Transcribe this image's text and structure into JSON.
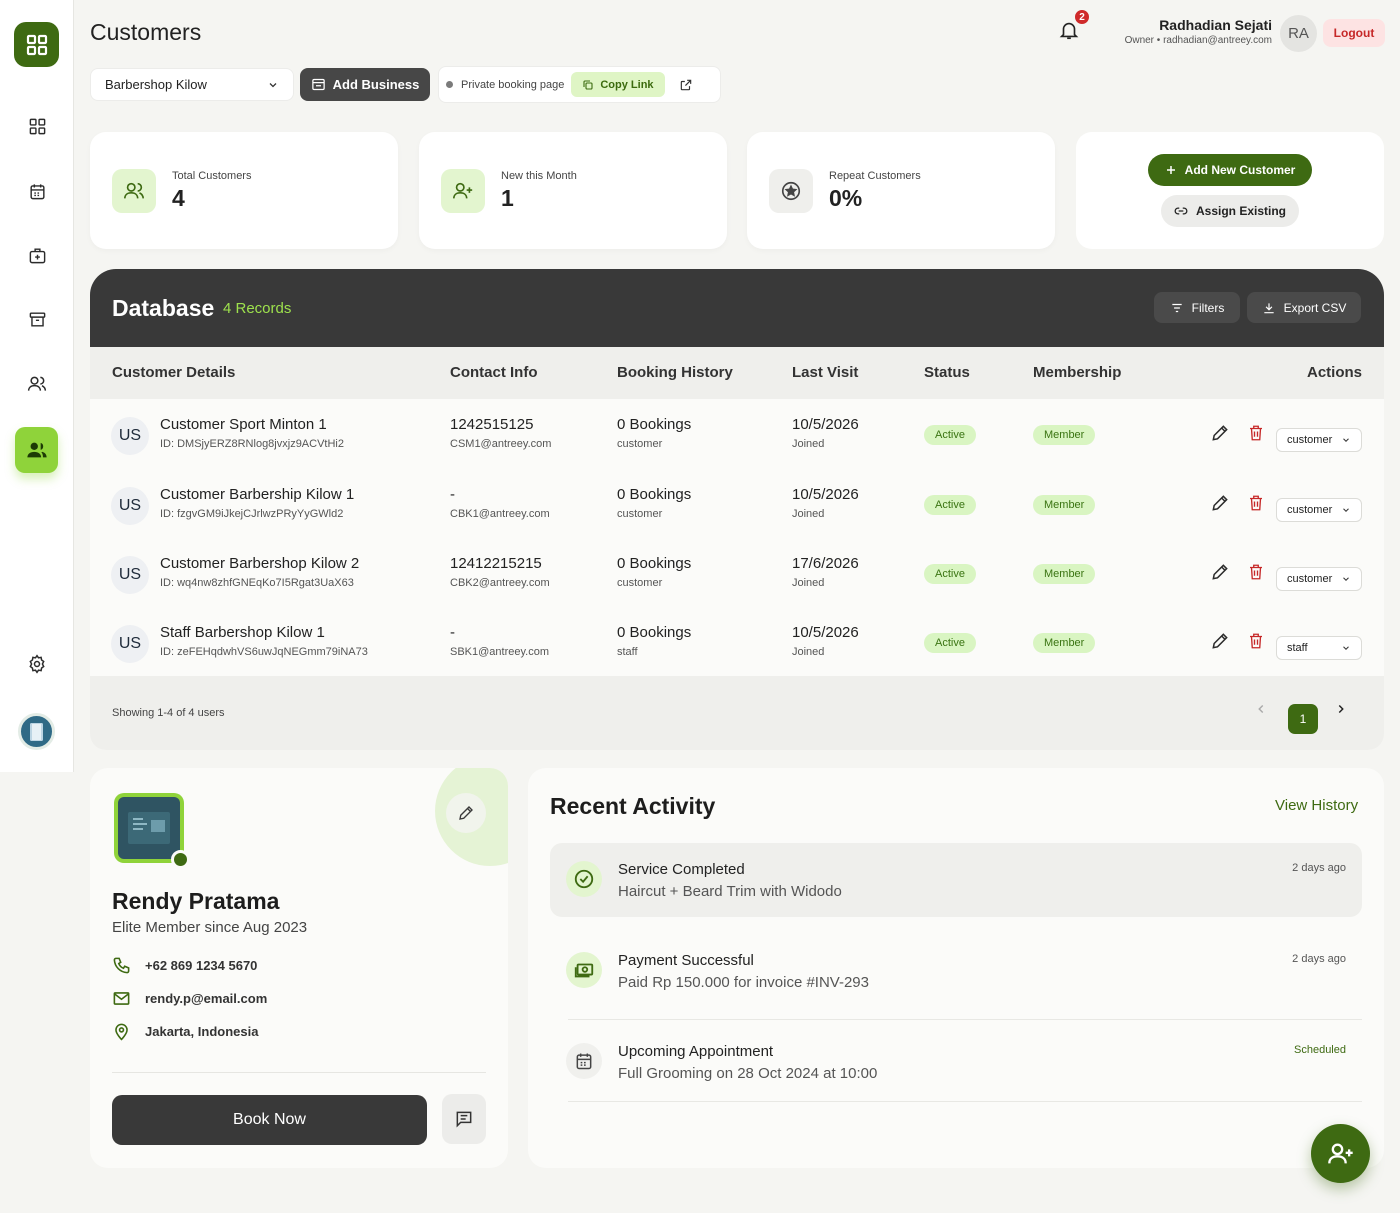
{
  "header": {
    "title": "Customers",
    "notification_count": "2",
    "user_name": "Radhadian Sejati",
    "user_sub": "Owner • radhadian@antreey.com",
    "user_initials": "RA",
    "logout_label": "Logout"
  },
  "toolbar": {
    "business_select": "Barbershop Kilow",
    "add_business_label": "Add Business",
    "private_booking_label": "Private booking page",
    "copy_link_label": "Copy Link"
  },
  "stats": [
    {
      "label": "Total Customers",
      "value": "4",
      "icon": "users-icon"
    },
    {
      "label": "New this Month",
      "value": "1",
      "icon": "user-plus-icon"
    },
    {
      "label": "Repeat Customers",
      "value": "0%",
      "icon": "star-icon"
    }
  ],
  "actions": {
    "add_new_customer": "Add New Customer",
    "assign_existing": "Assign Existing"
  },
  "database": {
    "title": "Database",
    "records": "4 Records",
    "filters_label": "Filters",
    "export_label": "Export CSV",
    "columns": [
      "Customer Details",
      "Contact Info",
      "Booking History",
      "Last Visit",
      "Status",
      "Membership",
      "Actions"
    ],
    "rows": [
      {
        "initials": "US",
        "name": "Customer Sport Minton 1",
        "id": "ID: DMSjyERZ8RNlog8jvxjz9ACVtHi2",
        "phone": "1242515125",
        "email": "CSM1@antreey.com",
        "bookings": "0 Bookings",
        "booking_role": "customer",
        "last_visit": "10/5/2026",
        "last_visit_sub": "Joined",
        "status": "Active",
        "membership": "Member",
        "role": "customer"
      },
      {
        "initials": "US",
        "name": "Customer Barbership Kilow 1",
        "id": "ID: fzgvGM9iJkejCJrlwzPRyYyGWld2",
        "phone": "-",
        "email": "CBK1@antreey.com",
        "bookings": "0 Bookings",
        "booking_role": "customer",
        "last_visit": "10/5/2026",
        "last_visit_sub": "Joined",
        "status": "Active",
        "membership": "Member",
        "role": "customer"
      },
      {
        "initials": "US",
        "name": "Customer Barbershop Kilow 2",
        "id": "ID: wq4nw8zhfGNEqKo7I5Rgat3UaX63",
        "phone": "12412215215",
        "email": "CBK2@antreey.com",
        "bookings": "0 Bookings",
        "booking_role": "customer",
        "last_visit": "17/6/2026",
        "last_visit_sub": "Joined",
        "status": "Active",
        "membership": "Member",
        "role": "customer"
      },
      {
        "initials": "US",
        "name": "Staff Barbershop Kilow 1",
        "id": "ID: zeFEHqdwhVS6uwJqNEGmm79iNA73",
        "phone": "-",
        "email": "SBK1@antreey.com",
        "bookings": "0 Bookings",
        "booking_role": "staff",
        "last_visit": "10/5/2026",
        "last_visit_sub": "Joined",
        "status": "Active",
        "membership": "Member",
        "role": "staff"
      }
    ],
    "showing": "Showing 1-4 of 4 users",
    "page": "1"
  },
  "profile": {
    "name": "Rendy Pratama",
    "since": "Elite Member since Aug 2023",
    "phone": "+62 869 1234 5670",
    "email": "rendy.p@email.com",
    "location": "Jakarta, Indonesia",
    "book_label": "Book Now"
  },
  "activity": {
    "title": "Recent Activity",
    "view_history": "View History",
    "items": [
      {
        "title": "Service Completed",
        "sub": "Haircut + Beard Trim with Widodo",
        "time": "2 days ago",
        "icon": "check-circle-icon"
      },
      {
        "title": "Payment Successful",
        "sub": "Paid Rp 150.000 for invoice #INV-293",
        "time": "2 days ago",
        "icon": "cash-icon"
      },
      {
        "title": "Upcoming Appointment",
        "sub": "Full Grooming on 28 Oct 2024 at 10:00",
        "time": "Scheduled",
        "icon": "calendar-icon"
      }
    ]
  },
  "colors": {
    "brand": "#3e6a12",
    "accent": "#8fd33a",
    "dark": "#393939",
    "danger": "#c62828"
  }
}
